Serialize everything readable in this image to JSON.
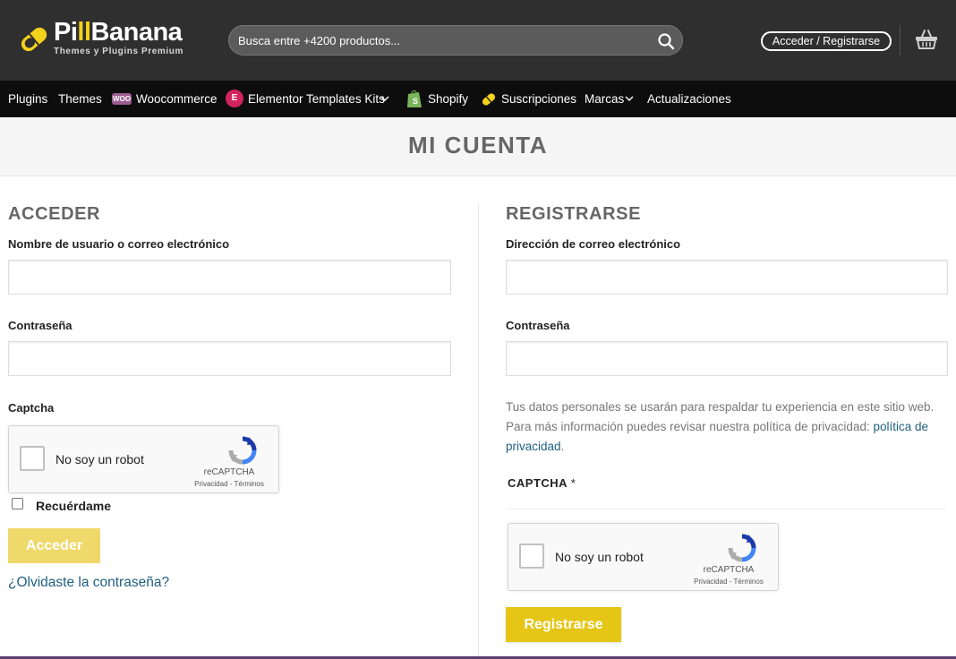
{
  "header": {
    "logo": {
      "brand_pre": "Pi",
      "brand_ll": "ll",
      "brand_post": "Banana",
      "tagline": "Themes y Plugins Premium"
    },
    "search": {
      "placeholder": "Busca entre +4200 productos...",
      "value": ""
    },
    "login_label": "Acceder / Registrarse"
  },
  "nav": {
    "plugins": "Plugins",
    "themes": "Themes",
    "woo_badge": "WOO",
    "woocommerce": "Woocommerce",
    "elementor_badge": "E",
    "elementor": "Elementor Templates Kits",
    "shopify": "Shopify",
    "suscripciones": "Suscripciones",
    "marcas": "Marcas",
    "actualizaciones": "Actualizaciones"
  },
  "page_title": "MI CUENTA",
  "login": {
    "heading": "ACCEDER",
    "username_label": "Nombre de usuario o correo electrónico",
    "username_value": "",
    "password_label": "Contraseña",
    "password_value": "",
    "captcha_label": "Captcha",
    "recaptcha": {
      "text": "No soy un robot",
      "brand": "reCAPTCHA",
      "links": "Privacidad - Términos"
    },
    "remember_label": "Recuérdame",
    "remember_checked": false,
    "submit_label": "Acceder",
    "forgot_link": "¿Olvidaste la contraseña?"
  },
  "register": {
    "heading": "REGISTRARSE",
    "email_label": "Dirección de correo electrónico",
    "email_value": "",
    "password_label": "Contraseña",
    "password_value": "",
    "privacy_text": "Tus datos personales se usarán para respaldar tu experiencia en este sitio web. Para más información puedes revisar nuestra política de privacidad: ",
    "privacy_link": "política de privacidad",
    "privacy_end": ".",
    "captcha_label": "CAPTCHA",
    "captcha_required": "*",
    "recaptcha": {
      "text": "No soy un robot",
      "brand": "reCAPTCHA",
      "links": "Privacidad - Términos"
    },
    "submit_label": "Registrarse"
  },
  "colors": {
    "header_bg": "#2f2f2f",
    "nav_bg": "#0d0d0d",
    "accent_yellow": "#e5c617",
    "login_button": "#f0d96b",
    "link": "#1f5f80"
  }
}
